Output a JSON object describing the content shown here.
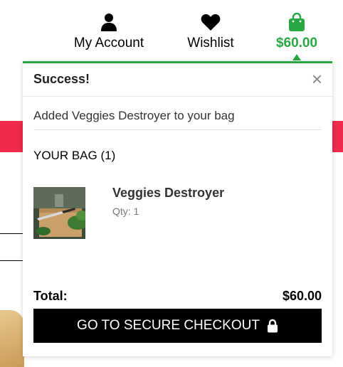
{
  "header": {
    "account_label": "My Account",
    "wishlist_label": "Wishlist",
    "bag_total": "$60.00",
    "bag_icon": "shopping-bag-icon",
    "account_icon": "user-icon",
    "wishlist_icon": "heart-icon"
  },
  "popup": {
    "title": "Success!",
    "close_label": "×",
    "message": "Added Veggies Destroyer to your bag",
    "bag_heading": "YOUR BAG (1)",
    "items": [
      {
        "name": "Veggies Destroyer",
        "qty": "Qty: 1"
      }
    ],
    "total_label": "Total:",
    "total_value": "$60.00",
    "checkout_label": "GO TO SECURE CHECKOUT",
    "checkout_icon": "lock-icon"
  },
  "colors": {
    "accent": "#28a745",
    "sale_bar": "#ee2a4b",
    "button": "#000000"
  }
}
